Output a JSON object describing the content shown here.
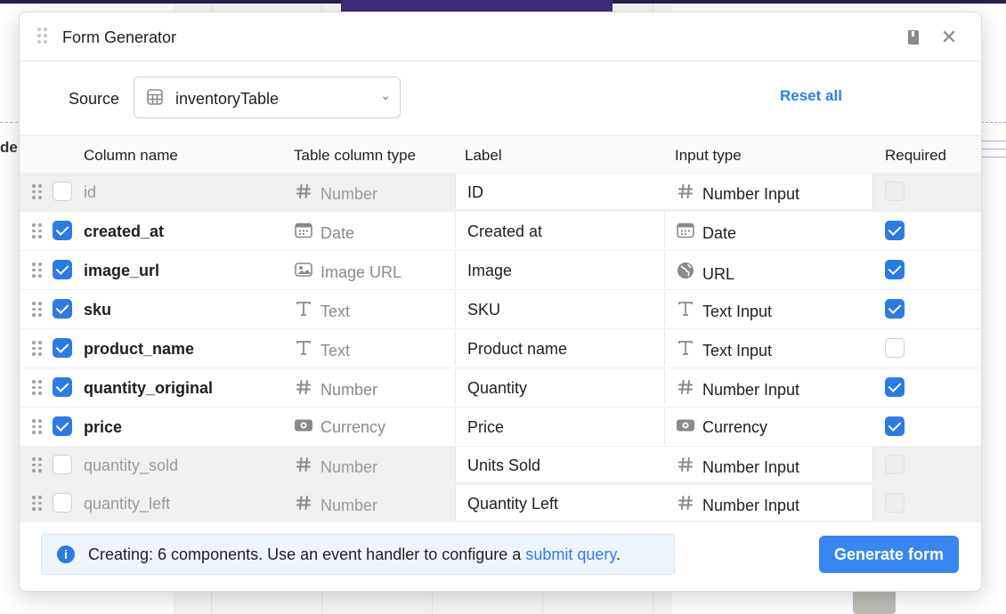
{
  "modal": {
    "title": "Form Generator",
    "source_label": "Source",
    "source_value": "inventoryTable",
    "reset_label": "Reset all"
  },
  "table": {
    "headers": [
      "Column name",
      "Table column type",
      "Label",
      "Input type",
      "Required"
    ],
    "rows": [
      {
        "name": "id",
        "type": "Number",
        "type_icon": "hash-icon",
        "label": "ID",
        "input": "Number Input",
        "input_icon": "hash-icon",
        "selected": false,
        "required": false
      },
      {
        "name": "created_at",
        "type": "Date",
        "type_icon": "calendar-icon",
        "label": "Created at",
        "input": "Date",
        "input_icon": "calendar-icon",
        "selected": true,
        "required": true
      },
      {
        "name": "image_url",
        "type": "Image URL",
        "type_icon": "image-icon",
        "label": "Image",
        "input": "URL",
        "input_icon": "globe-icon",
        "selected": true,
        "required": true
      },
      {
        "name": "sku",
        "type": "Text",
        "type_icon": "text-icon",
        "label": "SKU",
        "input": "Text Input",
        "input_icon": "text-icon",
        "selected": true,
        "required": true
      },
      {
        "name": "product_name",
        "type": "Text",
        "type_icon": "text-icon",
        "label": "Product name",
        "input": "Text Input",
        "input_icon": "text-icon",
        "selected": true,
        "required": false
      },
      {
        "name": "quantity_original",
        "type": "Number",
        "type_icon": "hash-icon",
        "label": "Quantity",
        "input": "Number Input",
        "input_icon": "hash-icon",
        "selected": true,
        "required": true
      },
      {
        "name": "price",
        "type": "Currency",
        "type_icon": "currency-icon",
        "label": "Price",
        "input": "Currency",
        "input_icon": "currency-icon",
        "selected": true,
        "required": true
      },
      {
        "name": "quantity_sold",
        "type": "Number",
        "type_icon": "hash-icon",
        "label": "Units Sold",
        "input": "Number Input",
        "input_icon": "hash-icon",
        "selected": false,
        "required": false
      },
      {
        "name": "quantity_left",
        "type": "Number",
        "type_icon": "hash-icon",
        "label": "Quantity Left",
        "input": "Number Input",
        "input_icon": "hash-icon",
        "selected": false,
        "required": false
      }
    ]
  },
  "footer": {
    "info_prefix": "Creating: 6 components. Use an event handler to configure a ",
    "info_link": "submit query",
    "info_suffix": ".",
    "generate_label": "Generate form"
  },
  "background": {
    "fragment": "de"
  }
}
